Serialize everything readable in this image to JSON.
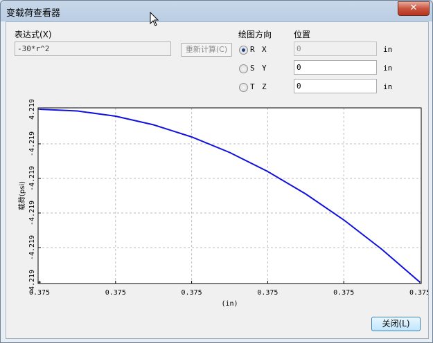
{
  "window": {
    "title": "变载荷查看器",
    "close_glyph": "✕"
  },
  "expression": {
    "label": "表达式(X)",
    "value": "-30*r^2"
  },
  "recalc_button": "重新计算(C)",
  "plot_direction": {
    "label": "绘图方向",
    "options": [
      {
        "letter": "R",
        "selected": true
      },
      {
        "letter": "S",
        "selected": false
      },
      {
        "letter": "T",
        "selected": false
      }
    ]
  },
  "position": {
    "label": "位置",
    "fields": [
      {
        "axis": "X",
        "value": "0",
        "unit": "in",
        "disabled": true
      },
      {
        "axis": "Y",
        "value": "0",
        "unit": "in",
        "disabled": false
      },
      {
        "axis": "Z",
        "value": "0",
        "unit": "in",
        "disabled": false
      }
    ]
  },
  "close_button": "关闭(L)",
  "chart_data": {
    "type": "line",
    "xlabel": "(in)",
    "ylabel": "载荷(psi)",
    "x_tick_labels": [
      "0.375",
      "0.375",
      "0.375",
      "0.375",
      "0.375",
      "0.375"
    ],
    "y_tick_labels": [
      "4.219",
      "-4.219",
      "-4.219",
      "-4.219",
      "-4.219",
      "-4.219"
    ],
    "grid": true,
    "line_color": "#1010e0",
    "series": [
      {
        "x": [
          0,
          0.1,
          0.2,
          0.3,
          0.4,
          0.5,
          0.6,
          0.7,
          0.8,
          0.9,
          1.0
        ],
        "y": [
          0,
          -0.01,
          -0.04,
          -0.09,
          -0.16,
          -0.25,
          -0.36,
          -0.49,
          -0.64,
          -0.81,
          -1.0
        ]
      }
    ]
  }
}
